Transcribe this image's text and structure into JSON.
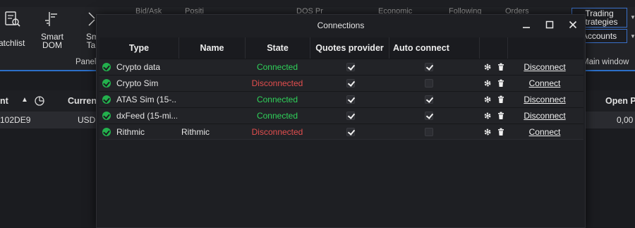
{
  "ribbon": {
    "top_tabs": [
      "Bid/Ask",
      "Positi",
      "DOS Pr",
      "Economic",
      "Following",
      "Orders"
    ],
    "buttons": [
      {
        "label": "atchlist",
        "icon": "watchlist-icon"
      },
      {
        "label": "Smart DOM",
        "icon": "smart-dom-icon"
      },
      {
        "label": "Sm Ta",
        "icon": "smart-tape-icon"
      }
    ],
    "panels_label": "Panels",
    "main_window_label": "Main window",
    "trading_strategies_label": "Trading strategies",
    "accounts_label": "Accounts"
  },
  "background_grid": {
    "headers": [
      "nt",
      "Curren",
      "Open P"
    ],
    "row": [
      "102DE9",
      "USD",
      "0,00"
    ]
  },
  "dialog": {
    "title": "Connections",
    "columns": [
      "Type",
      "Name",
      "State",
      "Quotes provider",
      "Auto connect"
    ],
    "rows": [
      {
        "type": "Crypto data",
        "name": "",
        "state": "Connected",
        "quotes_provider": true,
        "auto_connect": true,
        "action": "Disconnect"
      },
      {
        "type": "Crypto Sim",
        "name": "",
        "state": "Disconnected",
        "quotes_provider": true,
        "auto_connect": false,
        "action": "Connect"
      },
      {
        "type": "ATAS Sim (15-...",
        "name": "",
        "state": "Connected",
        "quotes_provider": true,
        "auto_connect": true,
        "action": "Disconnect"
      },
      {
        "type": "dxFeed (15-mi...",
        "name": "",
        "state": "Connected",
        "quotes_provider": true,
        "auto_connect": true,
        "action": "Disconnect"
      },
      {
        "type": "Rithmic",
        "name": "Rithmic",
        "state": "Disconnected",
        "quotes_provider": true,
        "auto_connect": false,
        "action": "Connect"
      }
    ]
  },
  "colors": {
    "connected": "#2fd15a",
    "disconnected": "#e34e4e",
    "status_ok": "#23b14d",
    "accent": "#2c6fc8"
  }
}
